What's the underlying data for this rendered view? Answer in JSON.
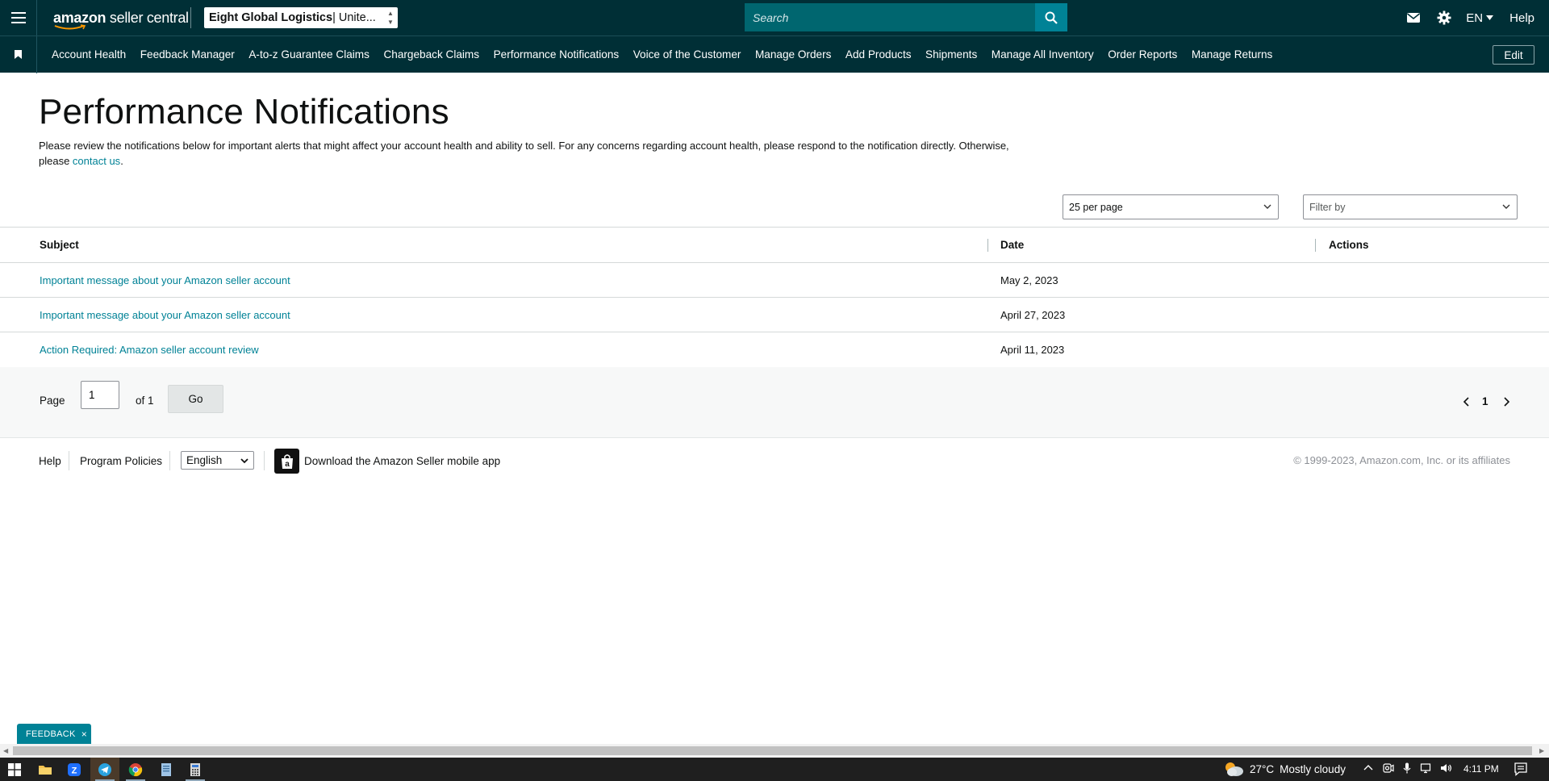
{
  "header": {
    "logo_bold": "amazon",
    "logo_rest": " seller central",
    "account_name": "Eight Global Logistics",
    "account_region": " | Unite...",
    "search_placeholder": "Search",
    "language": "EN",
    "help": "Help"
  },
  "nav": {
    "items": [
      "Account Health",
      "Feedback Manager",
      "A-to-z Guarantee Claims",
      "Chargeback Claims",
      "Performance Notifications",
      "Voice of the Customer",
      "Manage Orders",
      "Add Products",
      "Shipments",
      "Manage All Inventory",
      "Order Reports",
      "Manage Returns"
    ],
    "edit": "Edit"
  },
  "main": {
    "title": "Performance Notifications",
    "intro_text": "Please review the notifications below for important alerts that might affect your account health and ability to sell. For any concerns regarding account health, please respond to the notification directly. Otherwise, please ",
    "intro_link": "contact us",
    "intro_end": ".",
    "per_page": "25 per page",
    "filter_placeholder": "Filter by"
  },
  "table": {
    "columns": [
      "Subject",
      "Date",
      "Actions"
    ],
    "rows": [
      {
        "subject": "Important message about your Amazon seller account",
        "date": "May 2, 2023"
      },
      {
        "subject": "Important message about your Amazon seller account",
        "date": "April 27, 2023"
      },
      {
        "subject": "Action Required: Amazon seller account review",
        "date": "April 11, 2023"
      }
    ]
  },
  "pagination": {
    "page_label": "Page",
    "page_value": "1",
    "of_label": "of 1",
    "go": "Go",
    "current_page": "1"
  },
  "footer": {
    "help": "Help",
    "policies": "Program Policies",
    "language": "English",
    "app": "Download the Amazon Seller mobile app",
    "copyright": "© 1999-2023, Amazon.com, Inc. or its affiliates"
  },
  "feedback": {
    "label": "FEEDBACK",
    "close": "×"
  },
  "taskbar": {
    "temperature": "27°C",
    "weather": "Mostly cloudy",
    "time": "4:11 PM"
  },
  "colors": {
    "header_bg": "#002f36",
    "search_bg": "#00666f",
    "accent": "#008296",
    "link": "#008296"
  }
}
